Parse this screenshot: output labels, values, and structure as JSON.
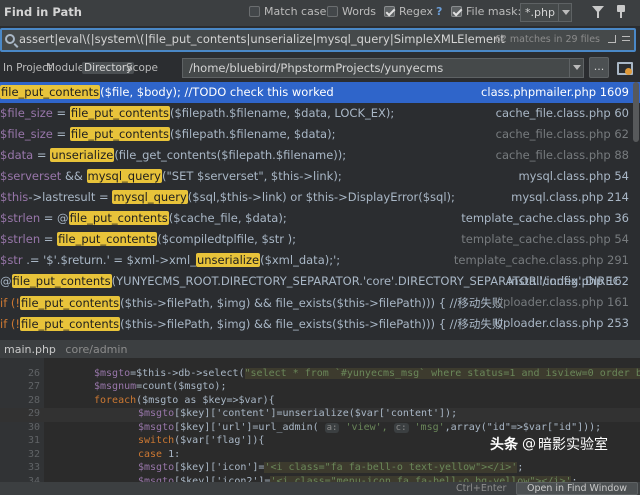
{
  "header": {
    "title": "Find in Path",
    "options": [
      {
        "label": "Match case",
        "checked": false
      },
      {
        "label": "Words",
        "checked": false
      },
      {
        "label": "Regex",
        "checked": true,
        "help": "?"
      },
      {
        "label": "File mask:",
        "checked": true
      }
    ],
    "file_mask": "*.php",
    "icons": [
      "filter-icon",
      "pin-icon"
    ]
  },
  "search": {
    "query": "assert|eval\\(|system\\(|file_put_contents|unserialize|mysql_query|SimpleXMLElement",
    "match_count": "62 matches in 29 files"
  },
  "scope": {
    "tabs": [
      {
        "label": "In Project",
        "selected": false
      },
      {
        "label": "Module",
        "selected": false
      },
      {
        "label": "Directory",
        "selected": true
      },
      {
        "label": "Scope",
        "selected": false
      }
    ],
    "directory": "/home/bluebird/PhpstormProjects/yunyecms",
    "browse_label": "..."
  },
  "results": [
    {
      "selected": true,
      "parts": [
        {
          "t": "file_put_contents",
          "c": "hl"
        },
        {
          "t": "($file, $body); //TODO check this worked",
          "c": ""
        }
      ],
      "file": "class.phpmailer.php 1609",
      "dim": false
    },
    {
      "selected": false,
      "parts": [
        {
          "t": "$file_size",
          "c": "vr"
        },
        {
          "t": " = ",
          "c": ""
        },
        {
          "t": "file_put_contents",
          "c": "hl"
        },
        {
          "t": "($filepath.$filename, $data, LOCK_EX);",
          "c": ""
        }
      ],
      "file": "cache_file.class.php 60",
      "dim": false
    },
    {
      "selected": false,
      "parts": [
        {
          "t": "$file_size",
          "c": "vr"
        },
        {
          "t": " = ",
          "c": ""
        },
        {
          "t": "file_put_contents",
          "c": "hl"
        },
        {
          "t": "($filepath.$filename, $data);",
          "c": ""
        }
      ],
      "file": "cache_file.class.php 62",
      "dim": true
    },
    {
      "selected": false,
      "parts": [
        {
          "t": "$data",
          "c": "vr"
        },
        {
          "t": " = ",
          "c": ""
        },
        {
          "t": "unserialize",
          "c": "hl"
        },
        {
          "t": "(file_get_contents($filepath.$filename));",
          "c": ""
        }
      ],
      "file": "cache_file.class.php 88",
      "dim": true
    },
    {
      "selected": false,
      "parts": [
        {
          "t": "$serverset",
          "c": "vr"
        },
        {
          "t": " && ",
          "c": ""
        },
        {
          "t": "mysql_query",
          "c": "hl"
        },
        {
          "t": "(\"SET $serverset\", $this->link);",
          "c": ""
        }
      ],
      "file": "mysql.class.php 54",
      "dim": false
    },
    {
      "selected": false,
      "parts": [
        {
          "t": "$this",
          "c": "vr"
        },
        {
          "t": "->lastresult = ",
          "c": ""
        },
        {
          "t": "mysql_query",
          "c": "hl"
        },
        {
          "t": "($sql,$this->link) or $this->DisplayError($sql);",
          "c": ""
        }
      ],
      "file": "mysql.class.php 214",
      "dim": false
    },
    {
      "selected": false,
      "parts": [
        {
          "t": "$strlen",
          "c": "vr"
        },
        {
          "t": " = @",
          "c": ""
        },
        {
          "t": "file_put_contents",
          "c": "hl"
        },
        {
          "t": "($cache_file, $data);",
          "c": ""
        }
      ],
      "file": "template_cache.class.php 36",
      "dim": false
    },
    {
      "selected": false,
      "parts": [
        {
          "t": "$strlen",
          "c": "vr"
        },
        {
          "t": " = ",
          "c": ""
        },
        {
          "t": "file_put_contents",
          "c": "hl"
        },
        {
          "t": "($compiledtplfile, $str );",
          "c": ""
        }
      ],
      "file": "template_cache.class.php 54",
      "dim": true
    },
    {
      "selected": false,
      "parts": [
        {
          "t": "$str",
          "c": "vr"
        },
        {
          "t": " .= '$'.$return.' = $xml->xml_",
          "c": ""
        },
        {
          "t": "unserialize",
          "c": "hl"
        },
        {
          "t": "($xml_data);';",
          "c": ""
        }
      ],
      "file": "template_cache.class.php 291",
      "dim": true
    },
    {
      "selected": false,
      "parts": [
        {
          "t": "@",
          "c": ""
        },
        {
          "t": "file_put_contents",
          "c": "hl"
        },
        {
          "t": "(YUNYECMS_ROOT.DIRECTORY_SEPARATOR.'core'.DIRECTORY_SEPARATOR.'config'.DIREC",
          "c": ""
        }
      ],
      "file": "install/index.php 162",
      "dim": false
    },
    {
      "selected": false,
      "parts": [
        {
          "t": "if (!",
          "c": "kw"
        },
        {
          "t": "file_put_contents",
          "c": "hl"
        },
        {
          "t": "($this->filePath, $img) && file_exists($this->filePath))) { //移动失败",
          "c": ""
        }
      ],
      "file": "Uploader.class.php 161",
      "dim": true
    },
    {
      "selected": false,
      "parts": [
        {
          "t": "if (!",
          "c": "kw"
        },
        {
          "t": "file_put_contents",
          "c": "hl"
        },
        {
          "t": "($this->filePath, $img) && file_exists($this->filePath))) { //移动失败",
          "c": ""
        }
      ],
      "file": "Uploader.class.php 253",
      "dim": false
    }
  ],
  "preview": {
    "file": "main.php",
    "path": "core/admin"
  },
  "editor": {
    "lines": [
      {
        "n": "",
        "indent": 0,
        "parts": [
          {
            "t": "",
            "c": ""
          }
        ]
      },
      {
        "n": "26",
        "indent": 0,
        "parts": [
          {
            "t": "$msgto",
            "c": "vr"
          },
          {
            "t": "=$this->db->select(",
            "c": ""
          },
          {
            "t": "\"select * from `#yunyecms_msg` where status=1 and isview=0 order by addtime desc \"",
            "c": "st sbg"
          },
          {
            "t": ");",
            "c": ""
          }
        ]
      },
      {
        "n": "27",
        "indent": 0,
        "parts": [
          {
            "t": "$msgnum",
            "c": "vr"
          },
          {
            "t": "=count($msgto);",
            "c": ""
          }
        ]
      },
      {
        "n": "28",
        "indent": 0,
        "parts": [
          {
            "t": "foreach",
            "c": "kw"
          },
          {
            "t": "($msgto as $key=>$var){",
            "c": ""
          }
        ]
      },
      {
        "n": "29",
        "indent": 1,
        "cur": true,
        "parts": [
          {
            "t": "$msgto",
            "c": "vr"
          },
          {
            "t": "[$key]['content']=unserialize($var['content']);",
            "c": ""
          }
        ]
      },
      {
        "n": "30",
        "indent": 1,
        "parts": [
          {
            "t": "$msgto",
            "c": "vr"
          },
          {
            "t": "[$key]['url']=url_admin( ",
            "c": ""
          },
          {
            "t": "a:",
            "c": "hint"
          },
          {
            "t": " 'view', ",
            "c": "st"
          },
          {
            "t": "c:",
            "c": "hint"
          },
          {
            "t": " 'msg'",
            "c": "st"
          },
          {
            "t": ",array(\"id\"=>$var[\"id\"]));",
            "c": ""
          }
        ]
      },
      {
        "n": "31",
        "indent": 1,
        "parts": [
          {
            "t": "switch",
            "c": "kw"
          },
          {
            "t": "($var['flag']){",
            "c": ""
          }
        ]
      },
      {
        "n": "32",
        "indent": 1,
        "parts": [
          {
            "t": " case ",
            "c": "kw"
          },
          {
            "t": "1:",
            "c": ""
          }
        ]
      },
      {
        "n": "33",
        "indent": 1,
        "parts": [
          {
            "t": " $msgto",
            "c": "vr"
          },
          {
            "t": "[$key]['icon']=",
            "c": ""
          },
          {
            "t": "'<i class=\"fa fa-bell-o text-yellow\"></i>'",
            "c": "st sbg"
          },
          {
            "t": ";",
            "c": ""
          }
        ]
      },
      {
        "n": "34",
        "indent": 1,
        "parts": [
          {
            "t": " $msgto",
            "c": "vr"
          },
          {
            "t": "[$key]['icon2']=",
            "c": ""
          },
          {
            "t": "'<i class=\"menu-icon fa fa-bell-o bg-yellow\"></i>'",
            "c": "st sbg"
          },
          {
            "t": ";",
            "c": ""
          }
        ]
      }
    ]
  },
  "bottom": {
    "shortcut": "Ctrl+Enter",
    "open_button": "Open in Find Window"
  },
  "watermark": {
    "logo": "头条",
    "at": "@",
    "name": "暗影实验室"
  }
}
